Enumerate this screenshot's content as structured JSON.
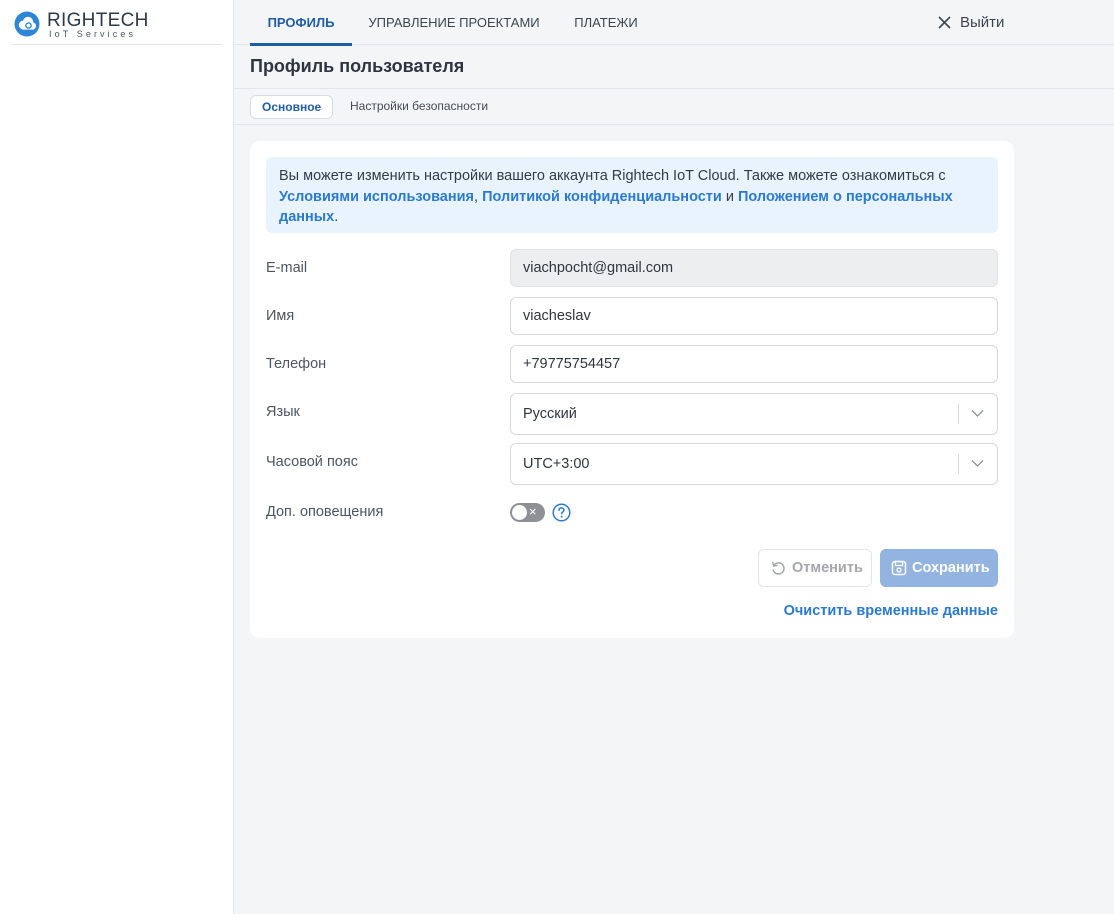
{
  "brand": {
    "name": "RIGHTECH",
    "subtitle": "IoT Services"
  },
  "topnav": {
    "tabs": [
      {
        "label": "ПРОФИЛЬ",
        "active": true
      },
      {
        "label": "УПРАВЛЕНИЕ ПРОЕКТАМИ",
        "active": false
      },
      {
        "label": "ПЛАТЕЖИ",
        "active": false
      }
    ],
    "logout_label": "Выйти"
  },
  "page": {
    "title": "Профиль пользователя",
    "subtabs": [
      {
        "label": "Основное",
        "active": true
      },
      {
        "label": "Настройки безопасности",
        "active": false
      }
    ]
  },
  "info": {
    "text_before": "Вы можете изменить настройки вашего аккаунта Rightech IoT Cloud. Также можете ознакомиться с ",
    "link_terms": "Условиями использования",
    "sep1": ", ",
    "link_privacy": "Политикой конфиденциальности",
    "sep2": " и ",
    "link_personal": "Положением о персональных данных",
    "text_after": "."
  },
  "form": {
    "email_label": "E-mail",
    "email_value": "viachpocht@gmail.com",
    "name_label": "Имя",
    "name_value": "viacheslav",
    "phone_label": "Телефон",
    "phone_value": "+79775754457",
    "language_label": "Язык",
    "language_value": "Русский",
    "timezone_label": "Часовой пояс",
    "timezone_value": "UTC+3:00",
    "notifications_label": "Доп. оповещения",
    "notifications_enabled": false,
    "notifications_toggle_mark": "×",
    "help_icon": "question-circle-icon"
  },
  "actions": {
    "cancel_label": "Отменить",
    "save_label": "Сохранить",
    "clear_label": "Очистить временные данные"
  },
  "colors": {
    "accent": "#1e5ea8",
    "link": "#2a7ad0",
    "info_bg": "#e9f3fd",
    "save_disabled": "#93b3e0",
    "page_bg": "#f4f5f7"
  }
}
